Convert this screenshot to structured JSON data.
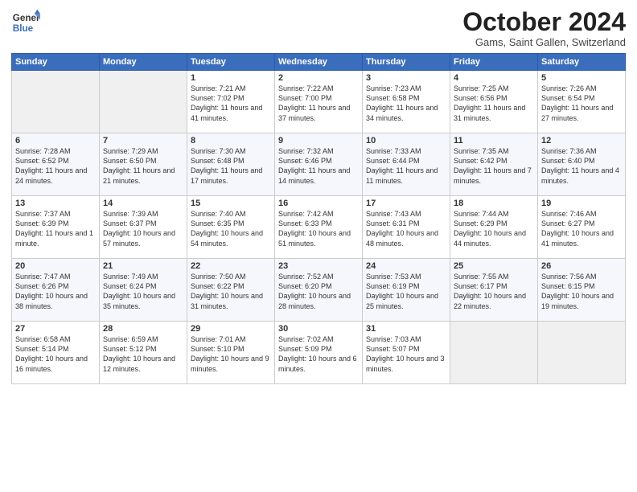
{
  "logo": {
    "general": "General",
    "blue": "Blue"
  },
  "header": {
    "month": "October 2024",
    "location": "Gams, Saint Gallen, Switzerland"
  },
  "weekdays": [
    "Sunday",
    "Monday",
    "Tuesday",
    "Wednesday",
    "Thursday",
    "Friday",
    "Saturday"
  ],
  "weeks": [
    [
      {
        "day": "",
        "empty": true
      },
      {
        "day": "",
        "empty": true
      },
      {
        "day": "1",
        "sunrise": "7:21 AM",
        "sunset": "7:02 PM",
        "daylight": "11 hours and 41 minutes."
      },
      {
        "day": "2",
        "sunrise": "7:22 AM",
        "sunset": "7:00 PM",
        "daylight": "11 hours and 37 minutes."
      },
      {
        "day": "3",
        "sunrise": "7:23 AM",
        "sunset": "6:58 PM",
        "daylight": "11 hours and 34 minutes."
      },
      {
        "day": "4",
        "sunrise": "7:25 AM",
        "sunset": "6:56 PM",
        "daylight": "11 hours and 31 minutes."
      },
      {
        "day": "5",
        "sunrise": "7:26 AM",
        "sunset": "6:54 PM",
        "daylight": "11 hours and 27 minutes."
      }
    ],
    [
      {
        "day": "6",
        "sunrise": "7:28 AM",
        "sunset": "6:52 PM",
        "daylight": "11 hours and 24 minutes."
      },
      {
        "day": "7",
        "sunrise": "7:29 AM",
        "sunset": "6:50 PM",
        "daylight": "11 hours and 21 minutes."
      },
      {
        "day": "8",
        "sunrise": "7:30 AM",
        "sunset": "6:48 PM",
        "daylight": "11 hours and 17 minutes."
      },
      {
        "day": "9",
        "sunrise": "7:32 AM",
        "sunset": "6:46 PM",
        "daylight": "11 hours and 14 minutes."
      },
      {
        "day": "10",
        "sunrise": "7:33 AM",
        "sunset": "6:44 PM",
        "daylight": "11 hours and 11 minutes."
      },
      {
        "day": "11",
        "sunrise": "7:35 AM",
        "sunset": "6:42 PM",
        "daylight": "11 hours and 7 minutes."
      },
      {
        "day": "12",
        "sunrise": "7:36 AM",
        "sunset": "6:40 PM",
        "daylight": "11 hours and 4 minutes."
      }
    ],
    [
      {
        "day": "13",
        "sunrise": "7:37 AM",
        "sunset": "6:39 PM",
        "daylight": "11 hours and 1 minute."
      },
      {
        "day": "14",
        "sunrise": "7:39 AM",
        "sunset": "6:37 PM",
        "daylight": "10 hours and 57 minutes."
      },
      {
        "day": "15",
        "sunrise": "7:40 AM",
        "sunset": "6:35 PM",
        "daylight": "10 hours and 54 minutes."
      },
      {
        "day": "16",
        "sunrise": "7:42 AM",
        "sunset": "6:33 PM",
        "daylight": "10 hours and 51 minutes."
      },
      {
        "day": "17",
        "sunrise": "7:43 AM",
        "sunset": "6:31 PM",
        "daylight": "10 hours and 48 minutes."
      },
      {
        "day": "18",
        "sunrise": "7:44 AM",
        "sunset": "6:29 PM",
        "daylight": "10 hours and 44 minutes."
      },
      {
        "day": "19",
        "sunrise": "7:46 AM",
        "sunset": "6:27 PM",
        "daylight": "10 hours and 41 minutes."
      }
    ],
    [
      {
        "day": "20",
        "sunrise": "7:47 AM",
        "sunset": "6:26 PM",
        "daylight": "10 hours and 38 minutes."
      },
      {
        "day": "21",
        "sunrise": "7:49 AM",
        "sunset": "6:24 PM",
        "daylight": "10 hours and 35 minutes."
      },
      {
        "day": "22",
        "sunrise": "7:50 AM",
        "sunset": "6:22 PM",
        "daylight": "10 hours and 31 minutes."
      },
      {
        "day": "23",
        "sunrise": "7:52 AM",
        "sunset": "6:20 PM",
        "daylight": "10 hours and 28 minutes."
      },
      {
        "day": "24",
        "sunrise": "7:53 AM",
        "sunset": "6:19 PM",
        "daylight": "10 hours and 25 minutes."
      },
      {
        "day": "25",
        "sunrise": "7:55 AM",
        "sunset": "6:17 PM",
        "daylight": "10 hours and 22 minutes."
      },
      {
        "day": "26",
        "sunrise": "7:56 AM",
        "sunset": "6:15 PM",
        "daylight": "10 hours and 19 minutes."
      }
    ],
    [
      {
        "day": "27",
        "sunrise": "6:58 AM",
        "sunset": "5:14 PM",
        "daylight": "10 hours and 16 minutes."
      },
      {
        "day": "28",
        "sunrise": "6:59 AM",
        "sunset": "5:12 PM",
        "daylight": "10 hours and 12 minutes."
      },
      {
        "day": "29",
        "sunrise": "7:01 AM",
        "sunset": "5:10 PM",
        "daylight": "10 hours and 9 minutes."
      },
      {
        "day": "30",
        "sunrise": "7:02 AM",
        "sunset": "5:09 PM",
        "daylight": "10 hours and 6 minutes."
      },
      {
        "day": "31",
        "sunrise": "7:03 AM",
        "sunset": "5:07 PM",
        "daylight": "10 hours and 3 minutes."
      },
      {
        "day": "",
        "empty": true
      },
      {
        "day": "",
        "empty": true
      }
    ]
  ],
  "labels": {
    "sunrise": "Sunrise:",
    "sunset": "Sunset:",
    "daylight": "Daylight:"
  }
}
